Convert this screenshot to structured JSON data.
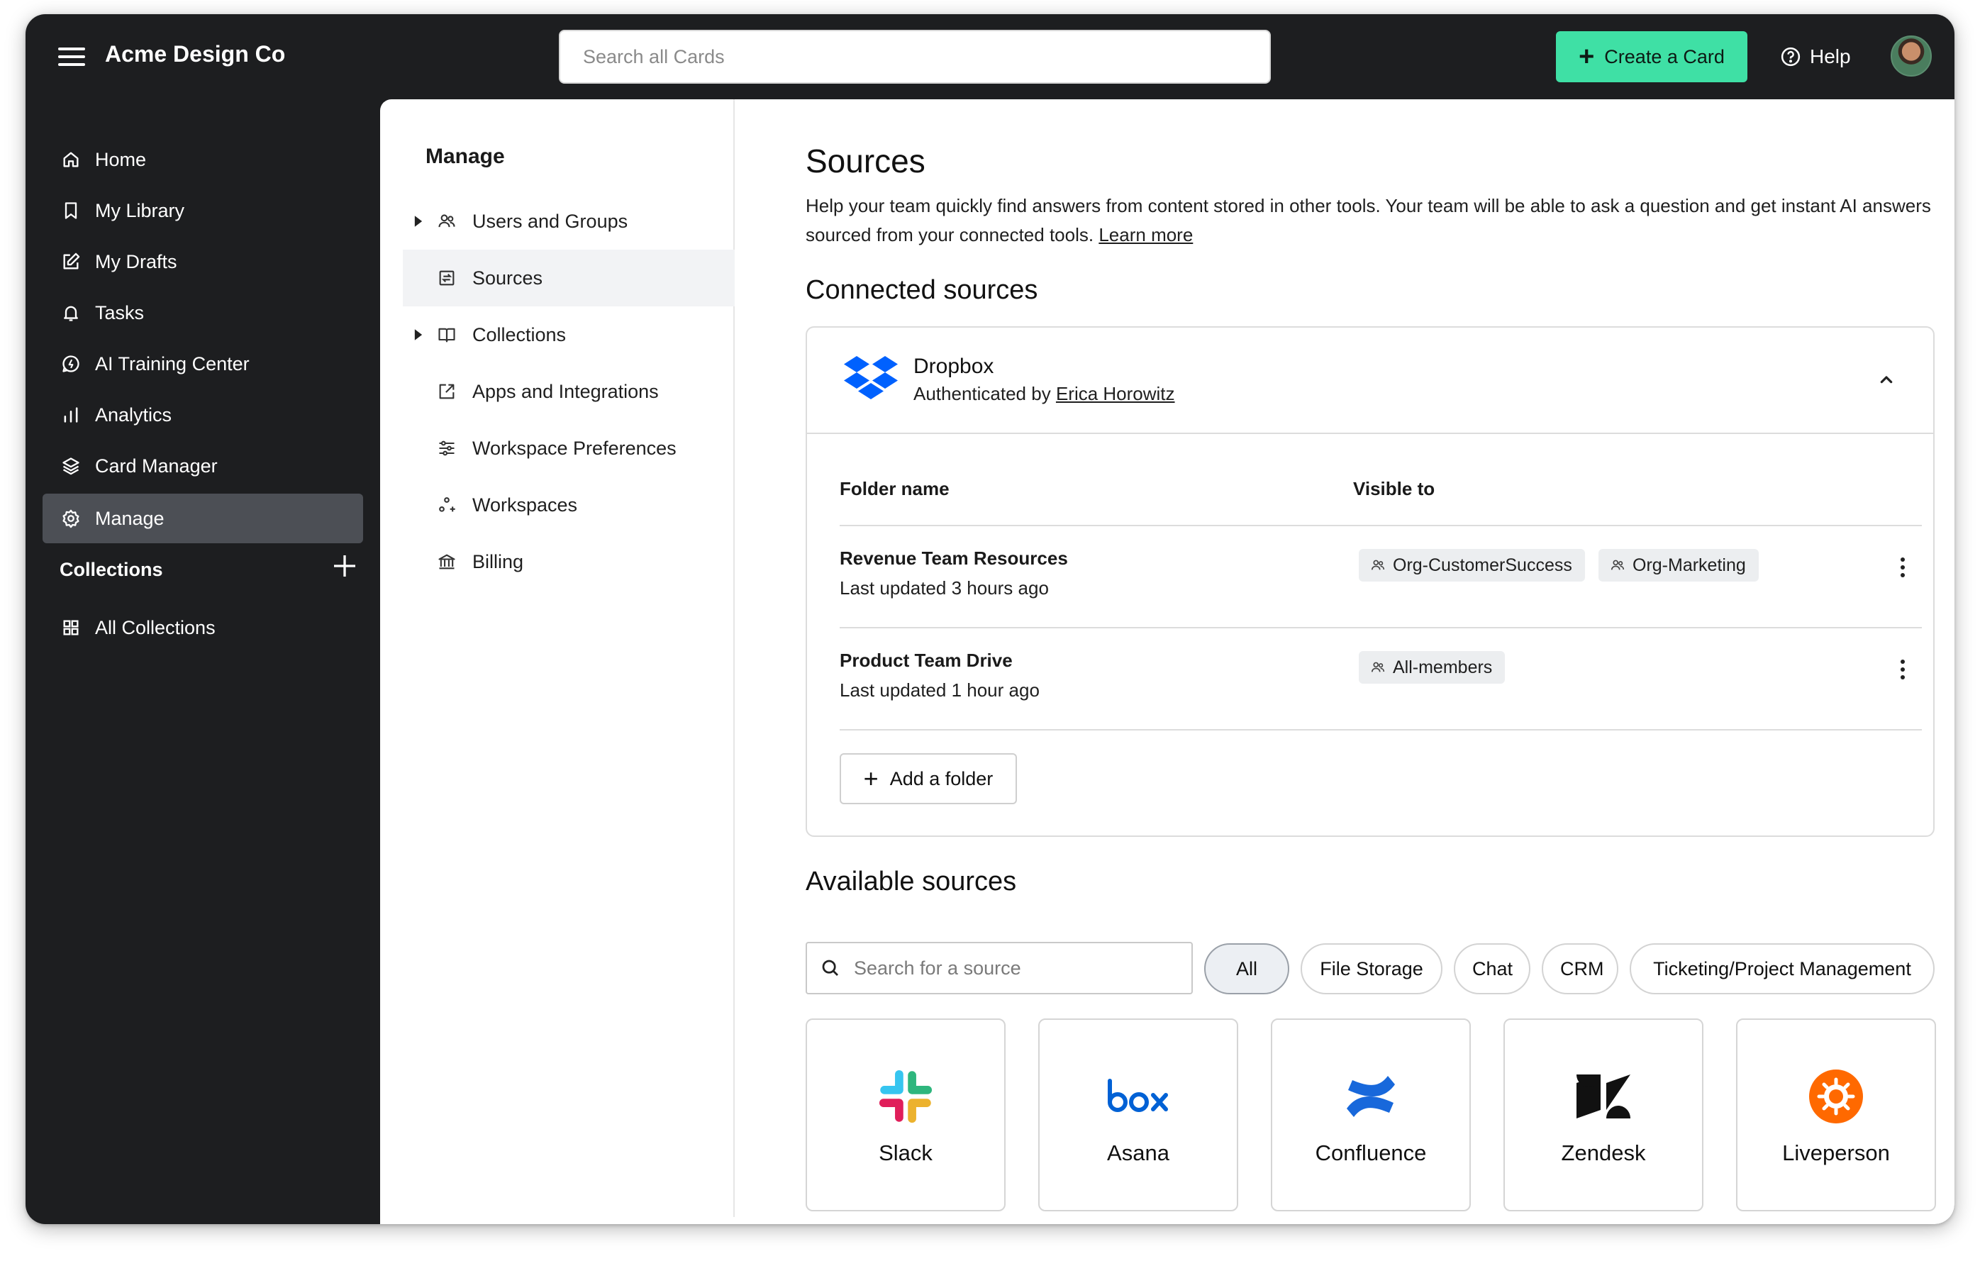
{
  "app": {
    "brand": "Acme Design Co",
    "search_placeholder": "Search all Cards",
    "create_label": "Create a Card",
    "help_label": "Help"
  },
  "sidebar": {
    "items": [
      {
        "label": "Home",
        "icon": "home-icon"
      },
      {
        "label": "My Library",
        "icon": "bookmark-icon"
      },
      {
        "label": "My Drafts",
        "icon": "edit-icon"
      },
      {
        "label": "Tasks",
        "icon": "bell-icon"
      },
      {
        "label": "AI Training Center",
        "icon": "ai-icon"
      },
      {
        "label": "Analytics",
        "icon": "bar-chart-icon"
      },
      {
        "label": "Card Manager",
        "icon": "layers-icon"
      },
      {
        "label": "Manage",
        "icon": "gear-icon",
        "active": true
      }
    ],
    "collections_heading": "Collections",
    "all_collections": "All Collections"
  },
  "subnav": {
    "title": "Manage",
    "items": [
      {
        "label": "Users and Groups",
        "icon": "users-icon",
        "expandable": true
      },
      {
        "label": "Sources",
        "icon": "sources-icon",
        "active": true
      },
      {
        "label": "Collections",
        "icon": "book-icon",
        "expandable": true
      },
      {
        "label": "Apps and Integrations",
        "icon": "external-link-icon"
      },
      {
        "label": "Workspace Preferences",
        "icon": "sliders-icon"
      },
      {
        "label": "Workspaces",
        "icon": "workspaces-icon"
      },
      {
        "label": "Billing",
        "icon": "bank-icon"
      }
    ]
  },
  "content": {
    "title": "Sources",
    "description": "Help your team quickly find answers from content stored in other tools. Your team will be able to ask a question and get instant AI answers sourced from your connected tools.",
    "learn_more": "Learn more",
    "connected_heading": "Connected sources",
    "connected": {
      "name": "Dropbox",
      "auth_prefix": "Authenticated by",
      "auth_user": "Erica Horowitz",
      "col_folder": "Folder name",
      "col_visible": "Visible to",
      "rows": [
        {
          "name": "Revenue Team Resources",
          "updated": "Last updated 3 hours ago",
          "groups": [
            "Org-CustomerSuccess",
            "Org-Marketing"
          ]
        },
        {
          "name": "Product Team Drive",
          "updated": "Last updated 1 hour ago",
          "groups": [
            "All-members"
          ]
        }
      ],
      "add_folder": "Add a folder"
    },
    "available_heading": "Available sources",
    "source_search_placeholder": "Search for a source",
    "filters": [
      "All",
      "File Storage",
      "Chat",
      "CRM",
      "Ticketing/Project Management"
    ],
    "active_filter": "All",
    "tiles": [
      "Slack",
      "Asana",
      "Confluence",
      "Zendesk",
      "Liveperson"
    ]
  },
  "colors": {
    "sidebar_bg": "#1d1e20",
    "accent": "#3fe0a5",
    "active_nav": "#4c4f55",
    "dropbox": "#0061fe",
    "confluence": "#1868db",
    "liveperson": "#ff6900"
  }
}
